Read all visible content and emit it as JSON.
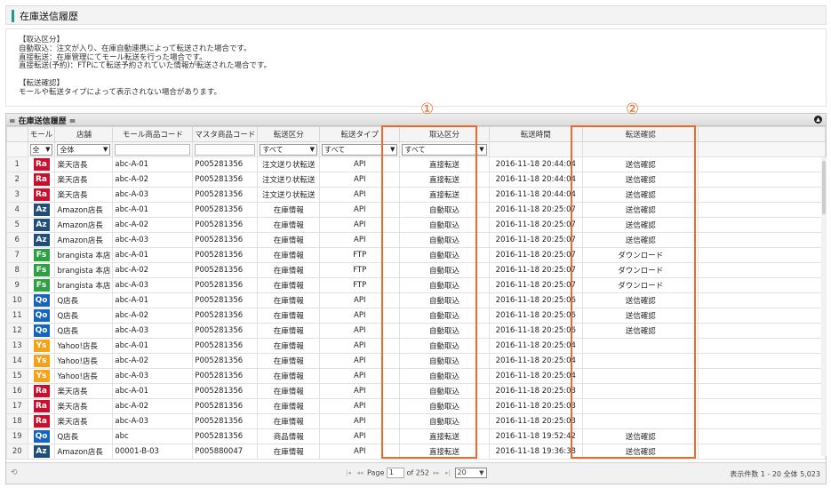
{
  "page": {
    "title": "在庫送信履歴"
  },
  "info": {
    "lines": [
      "【取込区分】",
      "自動取込：注文が入り、在庫自動連携によって転送された場合です。",
      "直接転送：在庫管理にてモール転送を行った場合です。",
      "直接転送(予約)：FTPにて転送予約されていた情報が転送された場合です。",
      "",
      "【転送確認】",
      "モールや転送タイプによって表示されない場合があります。"
    ]
  },
  "panel": {
    "title": "= 在庫送信履歴 ="
  },
  "columns": {
    "mall": "モール",
    "store": "店舗",
    "mall_code": "モール商品コード",
    "master_code": "マスタ商品コード",
    "send_type": "転送区分",
    "transfer_type": "転送タイプ",
    "import_type": "取込区分",
    "time": "転送時間",
    "confirm": "転送確認"
  },
  "filters": {
    "mall": "全",
    "store": "全体",
    "send_type": "すべて",
    "transfer_type": "すべて",
    "import_type": "すべて"
  },
  "badge_colors": {
    "Ra": "#c8102e",
    "Az": "#1f4e79",
    "Fs": "#2ea043",
    "Qo": "#1565c0",
    "Ys": "#f5a21b"
  },
  "rows": [
    {
      "n": "1",
      "mall": "Ra",
      "store": "楽天店長",
      "mcode": "abc-A-01",
      "master": "P005281356",
      "stype": "注文送り状転送",
      "ttype": "API",
      "itype": "直接転送",
      "time": "2016-11-18 20:44:04",
      "confirm": "送信確認"
    },
    {
      "n": "2",
      "mall": "Ra",
      "store": "楽天店長",
      "mcode": "abc-A-02",
      "master": "P005281356",
      "stype": "注文送り状転送",
      "ttype": "API",
      "itype": "直接転送",
      "time": "2016-11-18 20:44:04",
      "confirm": "送信確認"
    },
    {
      "n": "3",
      "mall": "Ra",
      "store": "楽天店長",
      "mcode": "abc-A-03",
      "master": "P005281356",
      "stype": "注文送り状転送",
      "ttype": "API",
      "itype": "直接転送",
      "time": "2016-11-18 20:44:04",
      "confirm": "送信確認"
    },
    {
      "n": "4",
      "mall": "Az",
      "store": "Amazon店長",
      "mcode": "abc-A-01",
      "master": "P005281356",
      "stype": "在庫情報",
      "ttype": "API",
      "itype": "自動取込",
      "time": "2016-11-18 20:25:07",
      "confirm": "送信確認"
    },
    {
      "n": "5",
      "mall": "Az",
      "store": "Amazon店長",
      "mcode": "abc-A-02",
      "master": "P005281356",
      "stype": "在庫情報",
      "ttype": "API",
      "itype": "自動取込",
      "time": "2016-11-18 20:25:07",
      "confirm": "送信確認"
    },
    {
      "n": "6",
      "mall": "Az",
      "store": "Amazon店長",
      "mcode": "abc-A-03",
      "master": "P005281356",
      "stype": "在庫情報",
      "ttype": "API",
      "itype": "自動取込",
      "time": "2016-11-18 20:25:07",
      "confirm": "送信確認"
    },
    {
      "n": "7",
      "mall": "Fs",
      "store": "brangista 本店",
      "mcode": "abc-A-01",
      "master": "P005281356",
      "stype": "在庫情報",
      "ttype": "FTP",
      "itype": "自動取込",
      "time": "2016-11-18 20:25:07",
      "confirm": "ダウンロード"
    },
    {
      "n": "8",
      "mall": "Fs",
      "store": "brangista 本店",
      "mcode": "abc-A-02",
      "master": "P005281356",
      "stype": "在庫情報",
      "ttype": "FTP",
      "itype": "自動取込",
      "time": "2016-11-18 20:25:07",
      "confirm": "ダウンロード"
    },
    {
      "n": "9",
      "mall": "Fs",
      "store": "brangista 本店",
      "mcode": "abc-A-03",
      "master": "P005281356",
      "stype": "在庫情報",
      "ttype": "FTP",
      "itype": "自動取込",
      "time": "2016-11-18 20:25:07",
      "confirm": "ダウンロード"
    },
    {
      "n": "10",
      "mall": "Qo",
      "store": "Q店長",
      "mcode": "abc-A-01",
      "master": "P005281356",
      "stype": "在庫情報",
      "ttype": "API",
      "itype": "自動取込",
      "time": "2016-11-18 20:25:06",
      "confirm": "送信確認"
    },
    {
      "n": "11",
      "mall": "Qo",
      "store": "Q店長",
      "mcode": "abc-A-02",
      "master": "P005281356",
      "stype": "在庫情報",
      "ttype": "API",
      "itype": "自動取込",
      "time": "2016-11-18 20:25:06",
      "confirm": "送信確認"
    },
    {
      "n": "12",
      "mall": "Qo",
      "store": "Q店長",
      "mcode": "abc-A-03",
      "master": "P005281356",
      "stype": "在庫情報",
      "ttype": "API",
      "itype": "自動取込",
      "time": "2016-11-18 20:25:06",
      "confirm": "送信確認"
    },
    {
      "n": "13",
      "mall": "Ys",
      "store": "Yahoo!店長",
      "mcode": "abc-A-01",
      "master": "P005281356",
      "stype": "在庫情報",
      "ttype": "API",
      "itype": "自動取込",
      "time": "2016-11-18 20:25:04",
      "confirm": ""
    },
    {
      "n": "14",
      "mall": "Ys",
      "store": "Yahoo!店長",
      "mcode": "abc-A-02",
      "master": "P005281356",
      "stype": "在庫情報",
      "ttype": "API",
      "itype": "自動取込",
      "time": "2016-11-18 20:25:04",
      "confirm": ""
    },
    {
      "n": "15",
      "mall": "Ys",
      "store": "Yahoo!店長",
      "mcode": "abc-A-03",
      "master": "P005281356",
      "stype": "在庫情報",
      "ttype": "API",
      "itype": "自動取込",
      "time": "2016-11-18 20:25:04",
      "confirm": ""
    },
    {
      "n": "16",
      "mall": "Ra",
      "store": "楽天店長",
      "mcode": "abc-A-01",
      "master": "P005281356",
      "stype": "在庫情報",
      "ttype": "API",
      "itype": "自動取込",
      "time": "2016-11-18 20:25:03",
      "confirm": ""
    },
    {
      "n": "17",
      "mall": "Ra",
      "store": "楽天店長",
      "mcode": "abc-A-02",
      "master": "P005281356",
      "stype": "在庫情報",
      "ttype": "API",
      "itype": "自動取込",
      "time": "2016-11-18 20:25:03",
      "confirm": ""
    },
    {
      "n": "18",
      "mall": "Ra",
      "store": "楽天店長",
      "mcode": "abc-A-03",
      "master": "P005281356",
      "stype": "在庫情報",
      "ttype": "API",
      "itype": "自動取込",
      "time": "2016-11-18 20:25:03",
      "confirm": ""
    },
    {
      "n": "19",
      "mall": "Qo",
      "store": "Q店長",
      "mcode": "abc",
      "master": "P005281356",
      "stype": "商品情報",
      "ttype": "API",
      "itype": "直接転送",
      "time": "2016-11-18 19:52:42",
      "confirm": "送信確認"
    },
    {
      "n": "20",
      "mall": "Az",
      "store": "Amazon店長",
      "mcode": "00001-B-03",
      "master": "P005880047",
      "stype": "在庫情報",
      "ttype": "API",
      "itype": "直接転送",
      "time": "2016-11-18 19:36:38",
      "confirm": "送信確認"
    }
  ],
  "pager": {
    "page_label": "Page",
    "page_value": "1",
    "of_label": "of 252",
    "rows_per_page": "20"
  },
  "record_info": "表示件数 1 - 20 全体 5,023",
  "annotations": {
    "mark1": "①",
    "mark2": "②",
    "color": "#ef6a2a"
  }
}
